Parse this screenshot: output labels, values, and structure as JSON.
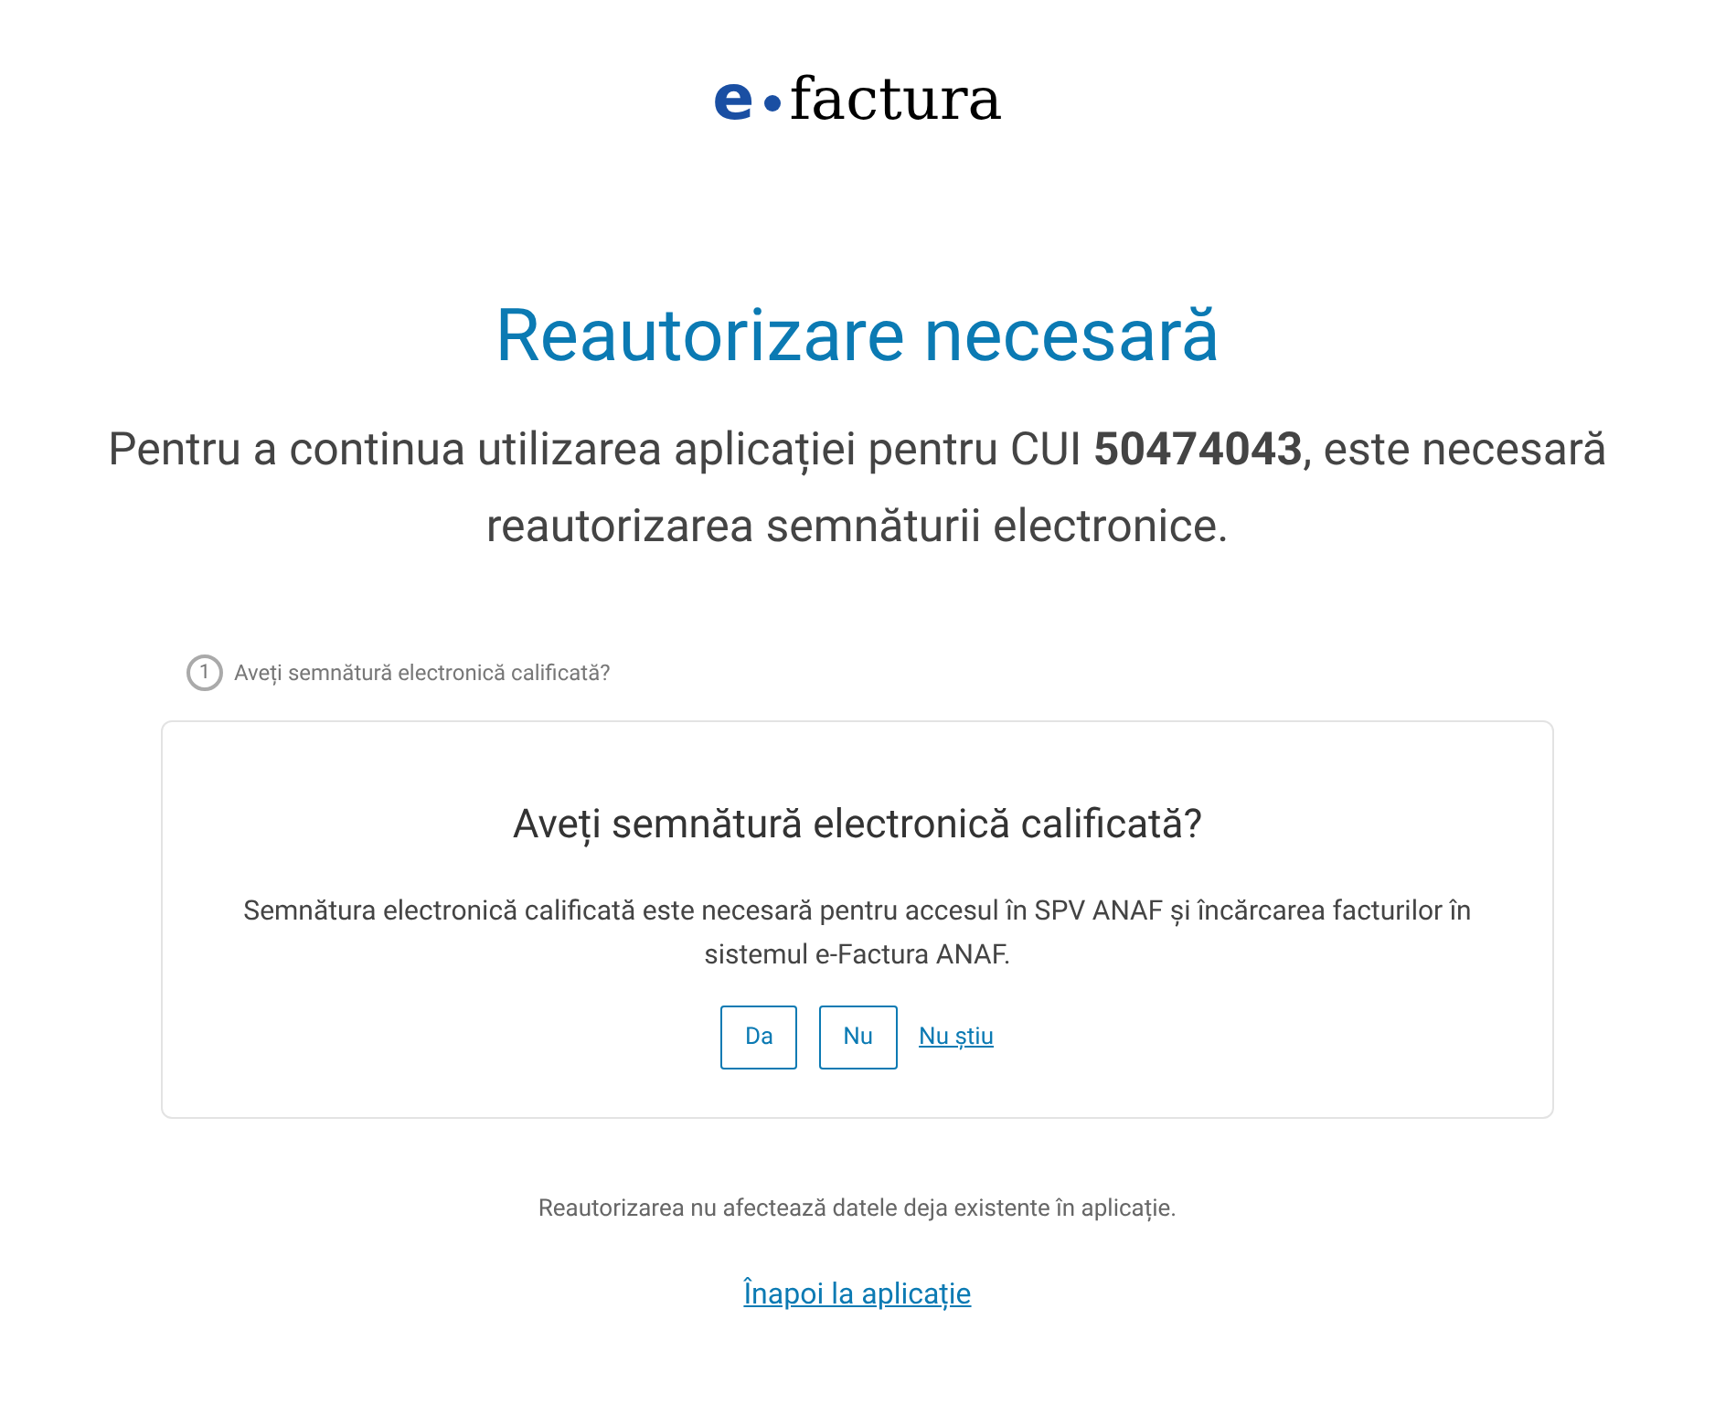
{
  "logo": {
    "prefix": "e",
    "name": "factura"
  },
  "title": "Reautorizare necesară",
  "intro": "Pentru a continua utilizarea aplicației pentru CUI **50474043**, este necesară reautorizarea semnăturii electronice.",
  "step": {
    "number": "1",
    "label": "Aveți semnătură electronică calificată?"
  },
  "card": {
    "question": "Aveți semnătură electronică calificată?",
    "description": "Semnătura electronică calificată este necesară pentru accesul în SPV ANAF și încărcarea facturilor în sistemul e-Factura ANAF.",
    "answers": [
      {
        "kind": "button",
        "label": "Da"
      },
      {
        "kind": "button",
        "label": "Nu"
      },
      {
        "kind": "link",
        "label": "Nu știu"
      }
    ]
  },
  "note": "Reautorizarea nu afectează datele deja existente în aplicație.",
  "back_link": "Înapoi la aplicație"
}
